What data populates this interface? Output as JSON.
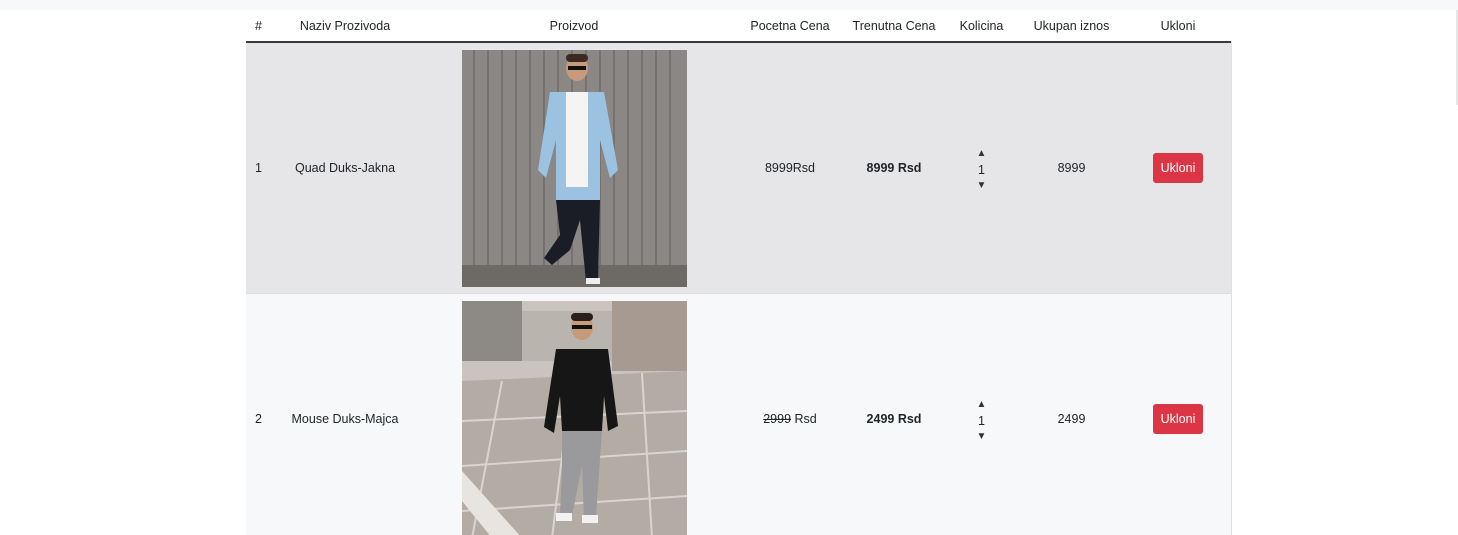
{
  "table": {
    "headers": {
      "num": "#",
      "name": "Naziv Prozivoda",
      "product": "Proizvod",
      "start_price": "Pocetna Cena",
      "current_price": "Trenutna Cena",
      "quantity": "Kolicina",
      "total": "Ukupan iznos",
      "remove": "Ukloni"
    },
    "rows": [
      {
        "num": "1",
        "name": "Quad Duks-Jakna",
        "start_price": "8999Rsd",
        "start_price_struck": "",
        "start_price_unit": "",
        "current_price": "8999 Rsd",
        "quantity": "1",
        "total": "8999",
        "remove_label": "Ukloni"
      },
      {
        "num": "2",
        "name": "Mouse Duks-Majca",
        "start_price": "",
        "start_price_struck": "2999",
        "start_price_unit": " Rsd",
        "current_price": "2499 Rsd",
        "quantity": "1",
        "total": "2499",
        "remove_label": "Ukloni"
      }
    ]
  },
  "icons": {
    "qty_up": "caret-up-icon",
    "qty_down": "caret-down-icon"
  },
  "colors": {
    "remove_button": "#dc3545",
    "row_odd": "#e6e6e8",
    "row_even": "#f7f8fa"
  }
}
